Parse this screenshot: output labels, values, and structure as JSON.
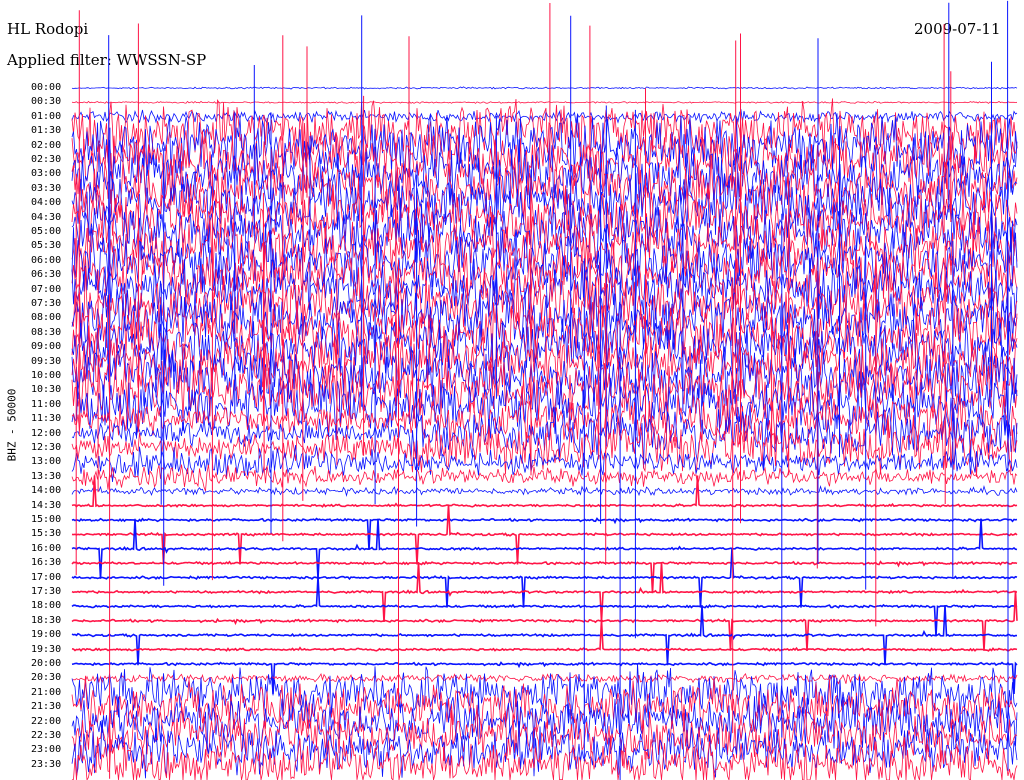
{
  "header": {
    "station": "HL Rodopi",
    "date": "2009-07-11",
    "filter": "Applied filter: WWSSN-SP"
  },
  "axis": {
    "channel_label": "BHZ - 50000"
  },
  "colors": {
    "trace_a": "#0a14ff",
    "trace_b": "#ff1446",
    "background": "#ffffff",
    "text": "#000000"
  },
  "chart_data": {
    "type": "line",
    "title": "HL Rodopi",
    "subtitle": "Applied filter: WWSSN-SP",
    "ylabel": "BHZ - 50000",
    "y_tick_labels": [
      "00:00",
      "00:30",
      "01:00",
      "01:30",
      "02:00",
      "02:30",
      "03:00",
      "03:30",
      "04:00",
      "04:30",
      "05:00",
      "05:30",
      "06:00",
      "06:30",
      "07:00",
      "07:30",
      "08:00",
      "08:30",
      "09:00",
      "09:30",
      "10:00",
      "10:30",
      "11:00",
      "11:30",
      "12:00",
      "12:30",
      "13:00",
      "13:30",
      "14:00",
      "14:30",
      "15:00",
      "15:30",
      "16:00",
      "16:30",
      "17:00",
      "17:30",
      "18:00",
      "18:30",
      "19:00",
      "19:30",
      "20:00",
      "20:30",
      "21:00",
      "21:30",
      "22:00",
      "22:30",
      "23:00",
      "23:30"
    ],
    "x_tick_labels": [],
    "grid": false,
    "legend": "none",
    "series": [
      {
        "color": "#0a14ff",
        "rows": "even (00:00, 01:00, ...)"
      },
      {
        "color": "#ff1446",
        "rows": "odd (00:30, 01:30, ...)"
      }
    ],
    "annotations": [
      "2009-07-11"
    ]
  }
}
